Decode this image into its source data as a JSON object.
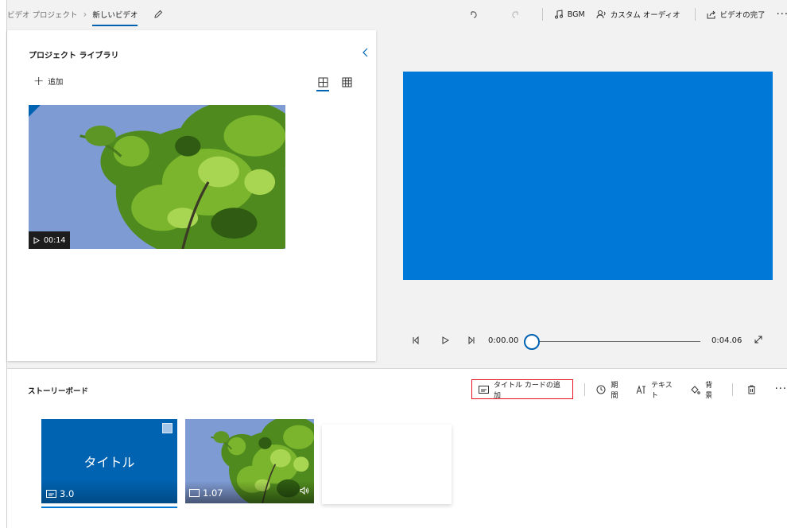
{
  "topbar": {
    "breadcrumb_root": "ビデオ プロジェクト",
    "breadcrumb_current": "新しいビデオ",
    "bgm_label": "BGM",
    "custom_audio_label": "カスタム オーディオ",
    "finish_label": "ビデオの完了"
  },
  "library": {
    "title": "プロジェクト ライブラリ",
    "add_label": "追加",
    "clip_duration": "00:14"
  },
  "player": {
    "current_time": "0:00.00",
    "end_time": "0:04.06",
    "progress": 0
  },
  "storyboard": {
    "title": "ストーリーボード",
    "add_title_card_label": "タイトル カードの追加",
    "duration_label": "期間",
    "text_label": "テキスト",
    "background_label": "背景",
    "cards": [
      {
        "title": "タイトル",
        "duration": "3.0"
      },
      {
        "duration": "1.07"
      }
    ]
  },
  "colors": {
    "accent": "#0063b1",
    "preview": "#0078d7",
    "highlight_border": "#e81123"
  }
}
